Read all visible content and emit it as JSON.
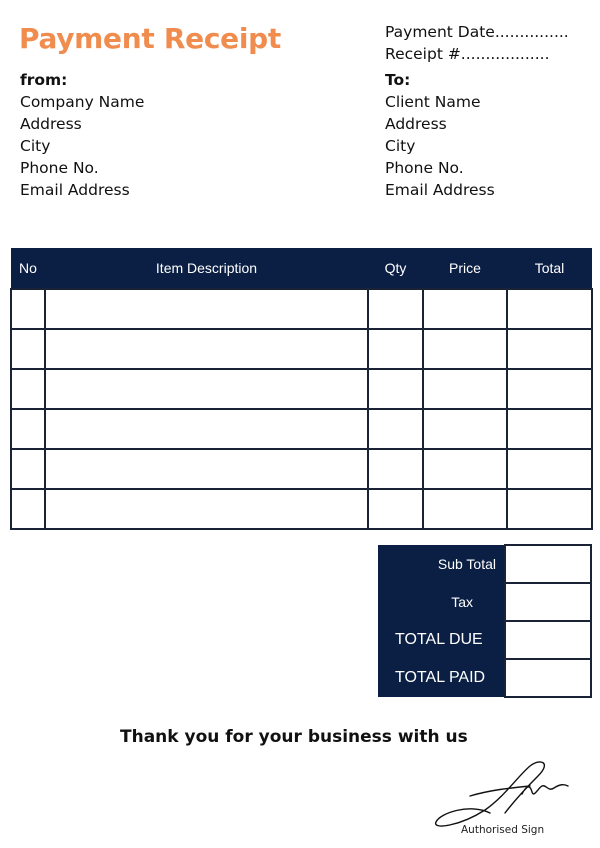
{
  "title": "Payment Receipt",
  "meta": {
    "payment_date": "Payment Date...............",
    "receipt_no": "Receipt #.................."
  },
  "from": {
    "heading": "from:",
    "lines": [
      "Company Name",
      "Address",
      "City",
      "Phone No.",
      "Email Address"
    ]
  },
  "to": {
    "heading": "To:",
    "lines": [
      "Client Name",
      "Address",
      "City",
      "Phone No.",
      "Email Address"
    ]
  },
  "items_table": {
    "headers": [
      "No",
      "Item Description",
      "Qty",
      "Price",
      "Total"
    ],
    "rows": [
      [
        "",
        "",
        "",
        "",
        ""
      ],
      [
        "",
        "",
        "",
        "",
        ""
      ],
      [
        "",
        "",
        "",
        "",
        ""
      ],
      [
        "",
        "",
        "",
        "",
        ""
      ],
      [
        "",
        "",
        "",
        "",
        ""
      ],
      [
        "",
        "",
        "",
        "",
        ""
      ]
    ]
  },
  "totals": {
    "sub_total_label": "Sub Total",
    "tax_label": "Tax",
    "total_due_label": "TOTAL DUE",
    "total_paid_label": "TOTAL PAID",
    "sub_total_value": "",
    "tax_value": "",
    "total_due_value": "",
    "total_paid_value": ""
  },
  "footer": {
    "thanks": "Thank you for your business with us",
    "signature_label": "Authorised Sign"
  },
  "colors": {
    "title": "#f08c4e",
    "header_bg": "#0b1f44"
  }
}
